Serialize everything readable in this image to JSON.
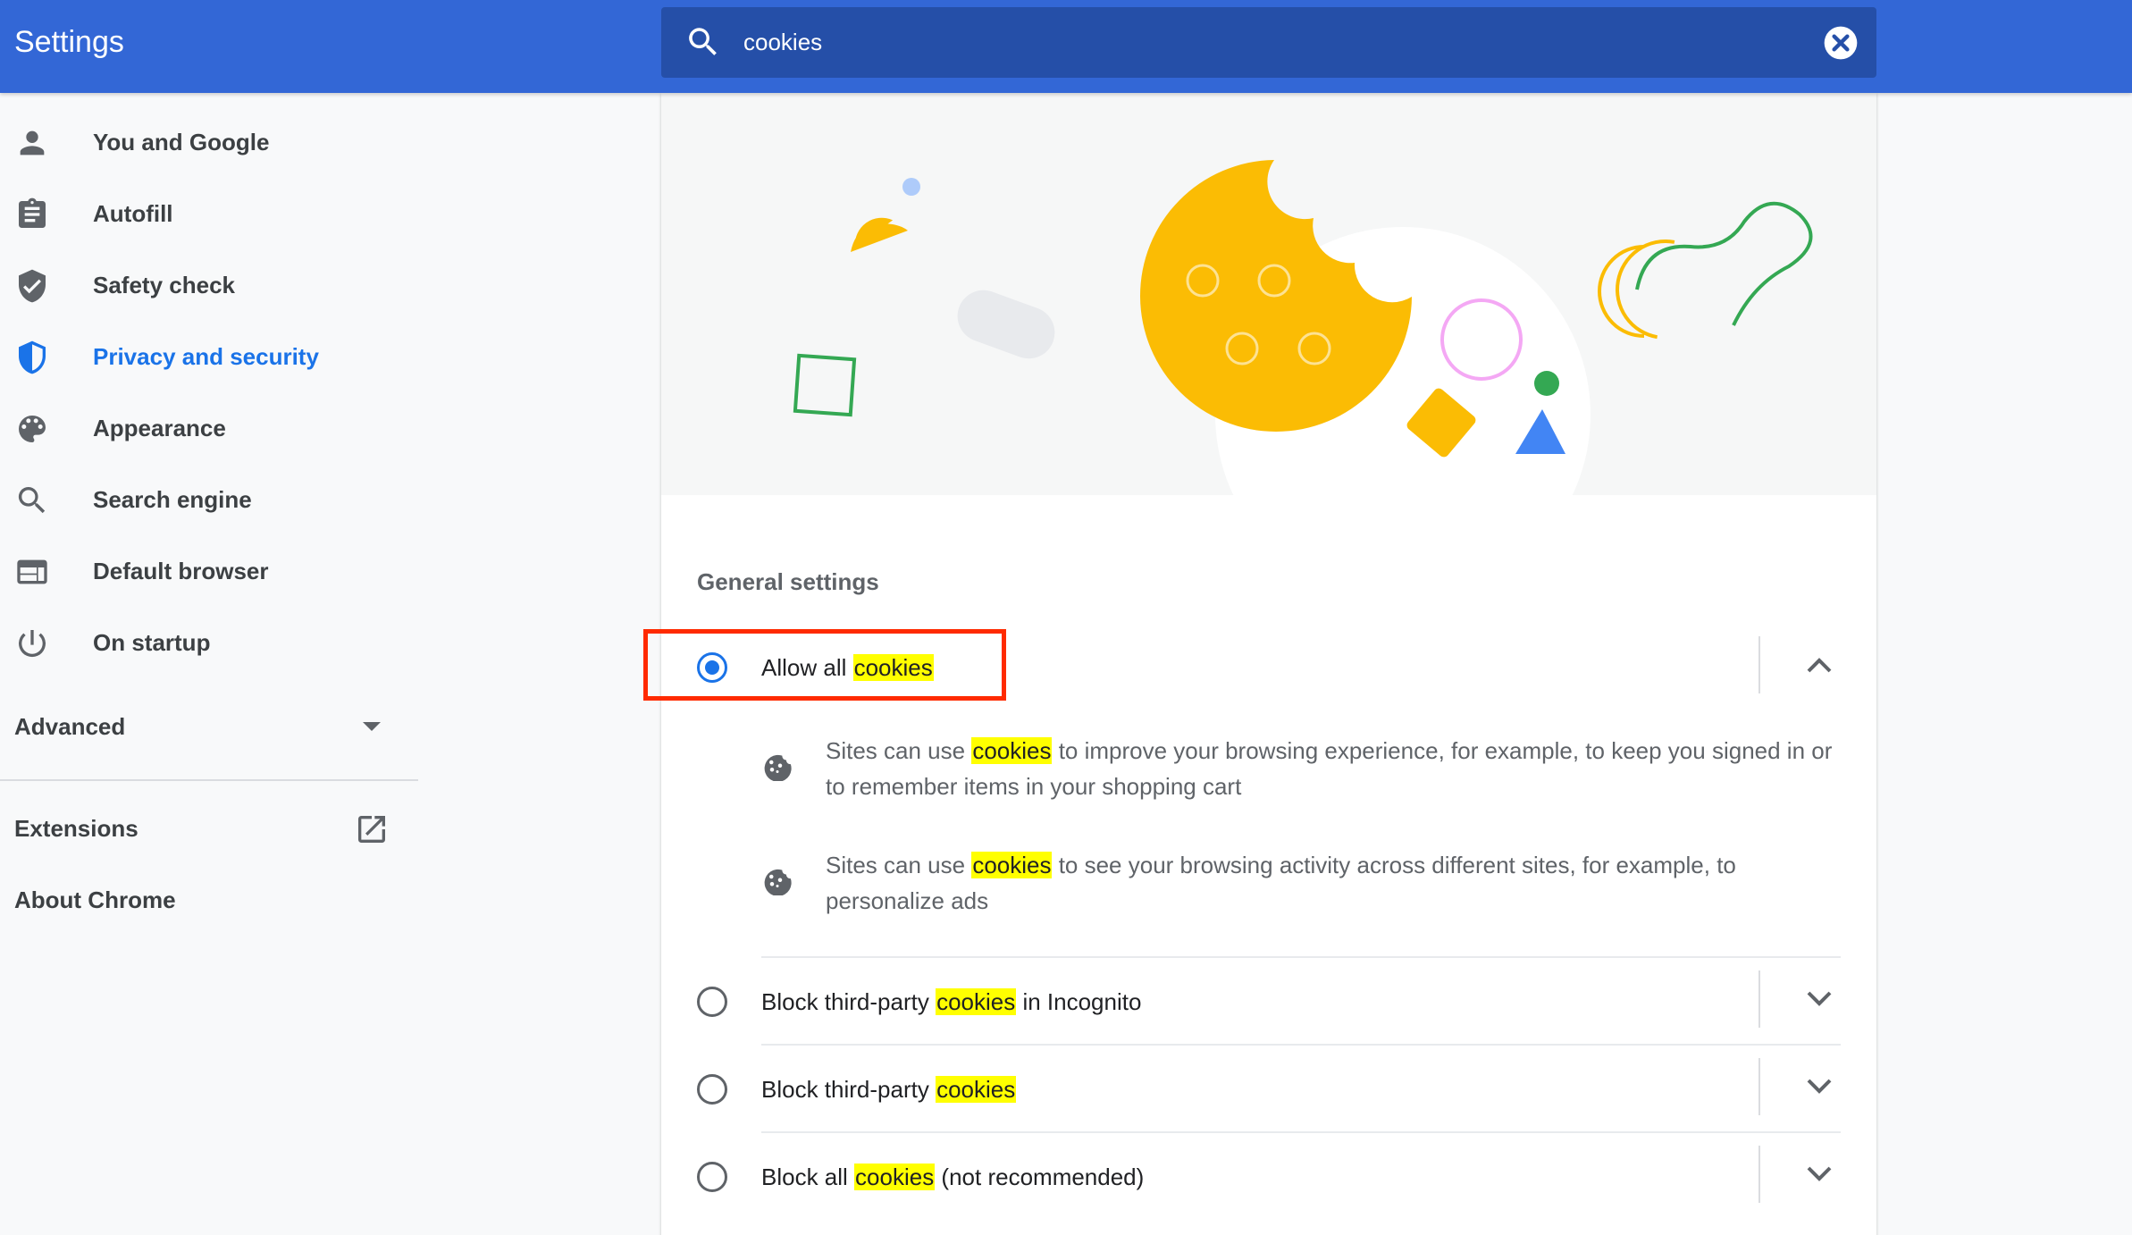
{
  "header": {
    "title": "Settings",
    "search_value": "cookies",
    "search_icon": "search-icon",
    "clear_icon": "close-circle-icon"
  },
  "sidebar": {
    "items": [
      {
        "label": "You and Google",
        "icon": "person-icon",
        "active": false
      },
      {
        "label": "Autofill",
        "icon": "clipboard-icon",
        "active": false
      },
      {
        "label": "Safety check",
        "icon": "shield-check-icon",
        "active": false
      },
      {
        "label": "Privacy and security",
        "icon": "shield-icon",
        "active": true
      },
      {
        "label": "Appearance",
        "icon": "palette-icon",
        "active": false
      },
      {
        "label": "Search engine",
        "icon": "search-icon",
        "active": false
      },
      {
        "label": "Default browser",
        "icon": "browser-icon",
        "active": false
      },
      {
        "label": "On startup",
        "icon": "power-icon",
        "active": false
      }
    ],
    "advanced_label": "Advanced",
    "extensions_label": "Extensions",
    "about_label": "About Chrome"
  },
  "main": {
    "section_title": "General settings",
    "highlight": "cookies",
    "options": [
      {
        "pre": "Allow all ",
        "hl": "cookies",
        "post": "",
        "selected": true,
        "expanded": true
      },
      {
        "pre": "Block third-party ",
        "hl": "cookies",
        "post": " in Incognito",
        "selected": false,
        "expanded": false
      },
      {
        "pre": "Block third-party ",
        "hl": "cookies",
        "post": "",
        "selected": false,
        "expanded": false
      },
      {
        "pre": "Block all ",
        "hl": "cookies",
        "post": " (not recommended)",
        "selected": false,
        "expanded": false
      }
    ],
    "descriptions": [
      {
        "pre": "Sites can use ",
        "hl": "cookies",
        "post": " to improve your browsing experience, for example, to keep you signed in or to remember items in your shopping cart",
        "icon": "cookie-icon"
      },
      {
        "pre": "Sites can use ",
        "hl": "cookies",
        "post": " to see your browsing activity across different sites, for example, to personalize ads",
        "icon": "cookie-icon"
      }
    ]
  },
  "colors": {
    "header_bg": "#3367d6",
    "search_bg": "#254fa8",
    "accent": "#1a73e8",
    "highlight": "#ffff00",
    "annotation_box": "#ff2a00"
  }
}
